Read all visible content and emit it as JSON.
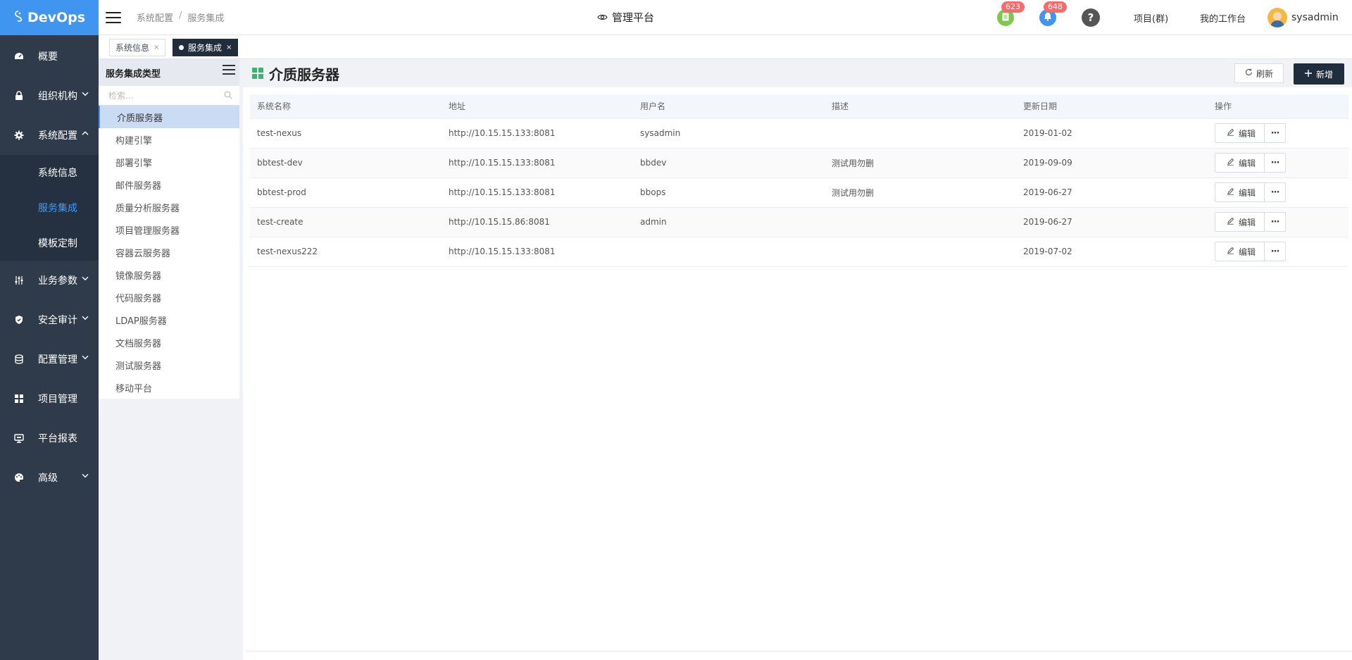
{
  "app": {
    "logo_text": "DevOps",
    "center_title": "管理平台",
    "badges": {
      "tasks": "623",
      "notifications": "648"
    },
    "links": {
      "projects": "项目(群)",
      "workspace": "我的工作台"
    },
    "username": "sysadmin"
  },
  "breadcrumb": [
    "系统配置",
    "服务集成"
  ],
  "sidebar": {
    "items": [
      {
        "label": "概要",
        "icon": "dashboard-icon"
      },
      {
        "label": "组织机构",
        "icon": "lock-icon"
      },
      {
        "label": "系统配置",
        "icon": "gear-icon"
      },
      {
        "label": "业务参数",
        "icon": "sliders-icon"
      },
      {
        "label": "安全审计",
        "icon": "shield-icon"
      },
      {
        "label": "配置管理",
        "icon": "database-icon"
      },
      {
        "label": "项目管理",
        "icon": "grid-icon"
      },
      {
        "label": "平台报表",
        "icon": "monitor-icon"
      },
      {
        "label": "高级",
        "icon": "palette-icon"
      }
    ],
    "submenu": [
      "系统信息",
      "服务集成",
      "模板定制"
    ]
  },
  "tabs": [
    {
      "label": "系统信息",
      "close": "×"
    },
    {
      "label": "服务集成",
      "close": "×"
    }
  ],
  "type_panel": {
    "title": "服务集成类型",
    "search_placeholder": "检索...",
    "items": [
      "介质服务器",
      "构建引擎",
      "部署引擎",
      "邮件服务器",
      "质量分析服务器",
      "项目管理服务器",
      "容器云服务器",
      "镜像服务器",
      "代码服务器",
      "LDAP服务器",
      "文档服务器",
      "测试服务器",
      "移动平台"
    ]
  },
  "main": {
    "title": "介质服务器",
    "refresh_label": "刷新",
    "new_label": "新增",
    "edit_label": "编辑",
    "more_label": "···",
    "columns": [
      "系统名称",
      "地址",
      "用户名",
      "描述",
      "更新日期",
      "操作"
    ],
    "rows": [
      [
        "test-nexus",
        "http://10.15.15.133:8081",
        "sysadmin",
        "",
        "2019-01-02"
      ],
      [
        "bbtest-dev",
        "http://10.15.15.133:8081",
        "bbdev",
        "测试用勿删",
        "2019-09-09"
      ],
      [
        "bbtest-prod",
        "http://10.15.15.133:8081",
        "bbops",
        "测试用勿删",
        "2019-06-27"
      ],
      [
        "test-create",
        "http://10.15.15.86:8081",
        "admin",
        "",
        "2019-06-27"
      ],
      [
        "test-nexus222",
        "http://10.15.15.133:8081",
        "",
        "",
        "2019-07-02"
      ]
    ]
  },
  "colors": {
    "accent": "#3f95f0",
    "sidebar": "#2f3a4a",
    "active_sub": "#3d9bff",
    "dark_button": "#1f2d3d"
  }
}
